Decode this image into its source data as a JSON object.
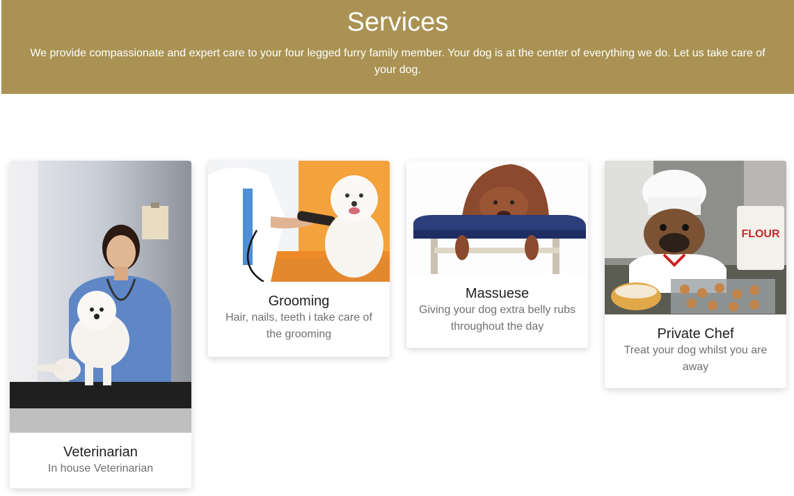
{
  "hero": {
    "title": "Services",
    "subtitle": "We provide compassionate and expert care to your four legged furry family member. Your dog is at the center of everything we do. Let us take care of your dog.",
    "background_color": "#a99253"
  },
  "services": [
    {
      "title": "Veterinarian",
      "description": "In house Veterinarian",
      "image": "veterinarian-with-white-dog-photo"
    },
    {
      "title": "Grooming",
      "description": "Hair, nails, teeth i take care of the grooming",
      "image": "grooming-white-dog-photo"
    },
    {
      "title": "Massuese",
      "description": "Giving your dog extra belly rubs throughout the day",
      "image": "dog-on-massage-table-photo"
    },
    {
      "title": "Private Chef",
      "description": "Treat your dog whilst you are away",
      "image": "bulldog-chef-baking-photo",
      "image_text": "FLOUR"
    }
  ]
}
